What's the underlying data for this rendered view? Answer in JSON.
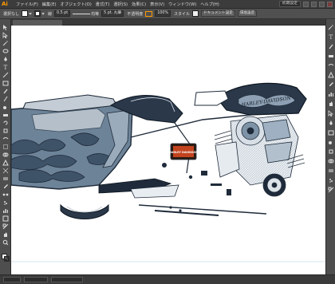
{
  "menubar": {
    "logo": "Ai",
    "items": [
      "ファイル(F)",
      "編集(E)",
      "オブジェクト(O)",
      "書式(T)",
      "選択(S)",
      "効果(C)",
      "表示(V)",
      "ウィンドウ(W)",
      "ヘルプ(H)"
    ],
    "workspace": "初期設定"
  },
  "control": {
    "selection_label": "選択なし",
    "stroke_label": "線",
    "stroke_weight": "0.5 pt",
    "stroke_style": "均等",
    "brush": "5 pt. 丸筆",
    "opacity_label": "不透明度",
    "opacity_value": "100%",
    "style_label": "スタイル",
    "doc_setup": "ドキュメント設定",
    "prefs": "環境設定"
  },
  "colors": {
    "fill": "#ffffff",
    "stroke": "#2b2b2b",
    "accent": "#ff9a00",
    "bike_blue": "#6d8398",
    "bike_dark": "#1f2b3a"
  },
  "artwork": {
    "tank_text": "HARLEY-DAVIDSON",
    "badge_text": "HARLEY DAVIDSON"
  },
  "tools": [
    "selection-tool-icon",
    "direct-selection-tool-icon",
    "magic-wand-tool-icon",
    "lasso-tool-icon",
    "pen-tool-icon",
    "type-tool-icon",
    "line-tool-icon",
    "rectangle-tool-icon",
    "paintbrush-tool-icon",
    "pencil-tool-icon",
    "blob-brush-tool-icon",
    "eraser-tool-icon",
    "rotate-tool-icon",
    "scale-tool-icon",
    "warp-tool-icon",
    "free-transform-tool-icon",
    "shape-builder-tool-icon",
    "perspective-grid-tool-icon",
    "mesh-tool-icon",
    "gradient-tool-icon",
    "eyedropper-tool-icon",
    "blend-tool-icon",
    "symbol-sprayer-tool-icon",
    "graph-tool-icon",
    "artboard-tool-icon",
    "slice-tool-icon",
    "hand-tool-icon",
    "zoom-tool-icon"
  ],
  "dock": [
    "color-panel-icon",
    "color-guide-panel-icon",
    "swatches-panel-icon",
    "brushes-panel-icon",
    "symbols-panel-icon",
    "graphic-styles-panel-icon",
    "stroke-panel-icon",
    "gradient-panel-icon",
    "transparency-panel-icon",
    "appearance-panel-icon",
    "layers-panel-icon",
    "artboards-panel-icon",
    "align-panel-icon",
    "pathfinder-panel-icon",
    "transform-panel-icon",
    "character-panel-icon",
    "paragraph-panel-icon",
    "links-panel-icon"
  ]
}
